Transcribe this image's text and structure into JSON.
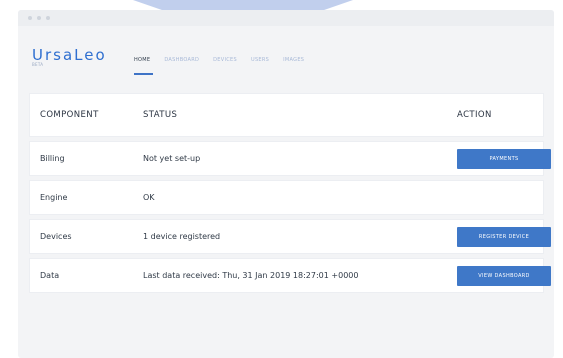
{
  "brand": {
    "name": "UrsaLeo",
    "tagline": "BETA"
  },
  "nav": {
    "tabs": [
      "HOME",
      "DASHBOARD",
      "DEVICES",
      "USERS",
      "IMAGES"
    ],
    "active_tab": "HOME"
  },
  "table": {
    "headers": {
      "component": "COMPONENT",
      "status": "STATUS",
      "action": "ACTION"
    },
    "rows": [
      {
        "component": "Billing",
        "status": "Not yet set-up",
        "action": "PAYMENTS"
      },
      {
        "component": "Engine",
        "status": "OK",
        "action": ""
      },
      {
        "component": "Devices",
        "status": "1 device registered",
        "action": "REGISTER DEVICE"
      },
      {
        "component": "Data",
        "status": "Last data received: Thu, 31 Jan 2019 18:27:01 +0000",
        "action": "VIEW DASHBOARD"
      }
    ]
  },
  "colors": {
    "accent": "#3f78c8",
    "brand": "#2f6fd0",
    "background": "#f3f4f6"
  }
}
